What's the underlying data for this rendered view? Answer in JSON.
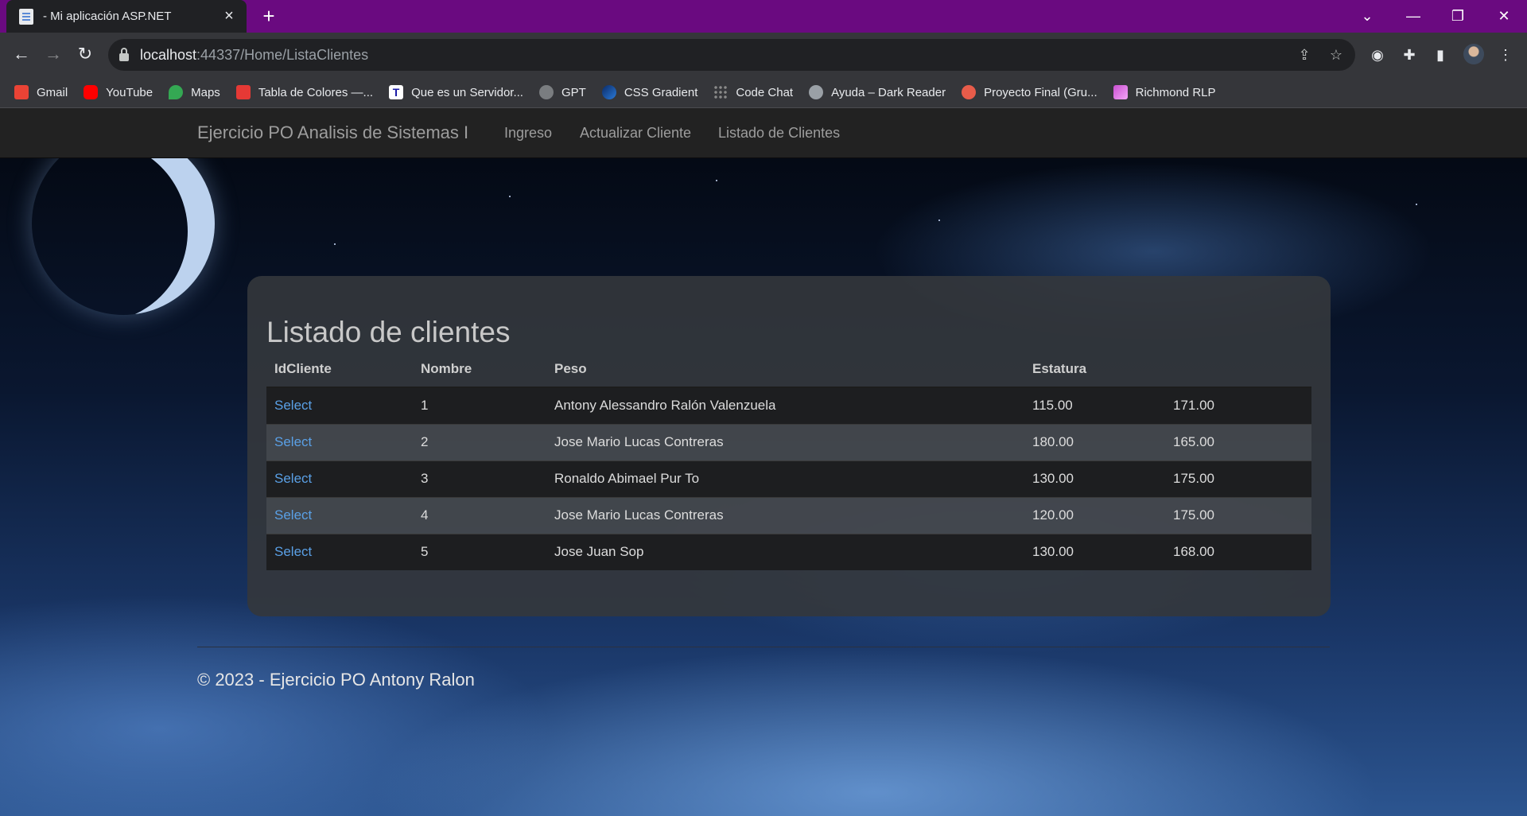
{
  "browser": {
    "tab_title": "- Mi aplicación ASP.NET",
    "url_host": "localhost",
    "url_path": ":44337/Home/ListaClientes",
    "bookmarks": [
      {
        "label": "Gmail",
        "icon": "gmail-icon",
        "color": "#ea4335"
      },
      {
        "label": "YouTube",
        "icon": "youtube-icon",
        "color": "#ff0000"
      },
      {
        "label": "Maps",
        "icon": "maps-icon",
        "color": "#34a853"
      },
      {
        "label": "Tabla de Colores —...",
        "icon": "color-table-icon",
        "color": "#e53935"
      },
      {
        "label": "Que es un Servidor...",
        "icon": "t-letter-icon",
        "color": "#1a1aa6"
      },
      {
        "label": "GPT",
        "icon": "gpt-icon",
        "color": "#7a7d80"
      },
      {
        "label": "CSS Gradient",
        "icon": "css-gradient-icon",
        "color": "#1e5aa8"
      },
      {
        "label": "Code Chat",
        "icon": "code-chat-icon",
        "color": "#8a8a8a"
      },
      {
        "label": "Ayuda – Dark Reader",
        "icon": "dark-reader-icon",
        "color": "#9aa0a6"
      },
      {
        "label": "Proyecto Final (Gru...",
        "icon": "project-icon",
        "color": "#e85c4a"
      },
      {
        "label": "Richmond RLP",
        "icon": "richmond-icon",
        "color": "#c94fd1"
      }
    ]
  },
  "site": {
    "brand": "Ejercicio PO Analisis de Sistemas I",
    "nav": [
      "Ingreso",
      "Actualizar Cliente",
      "Listado de Clientes"
    ]
  },
  "main": {
    "heading": "Listado de clientes",
    "columns": [
      "IdCliente",
      "Nombre",
      "Peso",
      "Estatura",
      ""
    ],
    "rows": [
      [
        "Select",
        "1",
        "Antony Alessandro Ralón Valenzuela",
        "115.00",
        "171.00"
      ],
      [
        "Select",
        "2",
        "Jose Mario Lucas Contreras",
        "180.00",
        "165.00"
      ],
      [
        "Select",
        "3",
        "Ronaldo Abimael Pur To",
        "130.00",
        "175.00"
      ],
      [
        "Select",
        "4",
        "Jose Mario Lucas Contreras",
        "120.00",
        "175.00"
      ],
      [
        "Select",
        "5",
        "Jose Juan Sop",
        "130.00",
        "168.00"
      ]
    ]
  },
  "footer": {
    "text": "© 2023 - Ejercicio PO Antony Ralon"
  },
  "colors": {
    "titlebar": "#6a0a80",
    "navbar": "#222222",
    "link": "#5aa0e6"
  }
}
